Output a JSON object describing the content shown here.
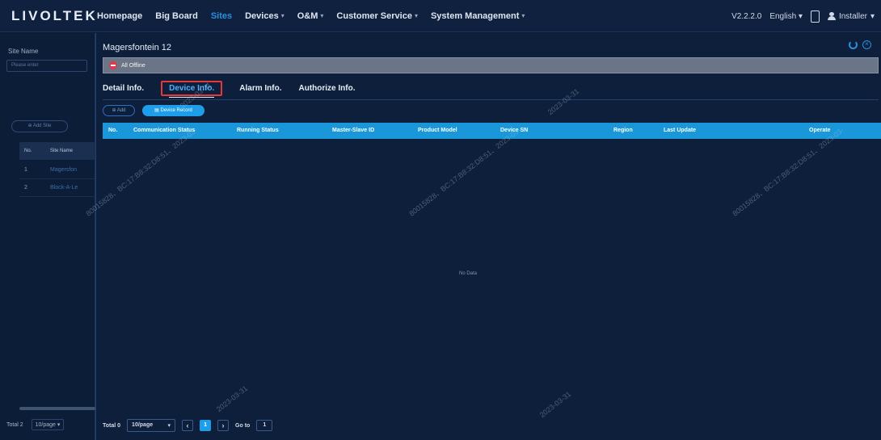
{
  "app": {
    "logo": "LIVOLTEK"
  },
  "nav": [
    {
      "label": "Homepage",
      "caret": false
    },
    {
      "label": "Big Board",
      "caret": false
    },
    {
      "label": "Sites",
      "caret": false,
      "active": true
    },
    {
      "label": "Devices",
      "caret": true
    },
    {
      "label": "O&M",
      "caret": true
    },
    {
      "label": "Customer Service",
      "caret": true
    },
    {
      "label": "System Management",
      "caret": true
    }
  ],
  "topright": {
    "version": "V2.2.2.0",
    "language": "English",
    "user": "Installer"
  },
  "left": {
    "site_name_label": "Site Name",
    "search_placeholder": "Please enter",
    "add_site": "⊕ Add Site",
    "col_no": "No.",
    "col_site": "Site Name",
    "rows": [
      {
        "no": "1",
        "name": "Magersfon"
      },
      {
        "no": "2",
        "name": "Block-A-Le"
      }
    ],
    "total": "Total 2",
    "page_size": "10/page"
  },
  "modal": {
    "title": "Magersfontein 12",
    "status": "All Offline",
    "tabs": [
      "Detail Info.",
      "Device Info.",
      "Alarm Info.",
      "Authorize Info."
    ],
    "active_tab": "Device Info.",
    "add_label": "⊕ Add",
    "record_label": "▤ Device Record",
    "columns": [
      "No.",
      "Communication Status",
      "Running Status",
      "Master-Slave ID",
      "Product Model",
      "Device SN",
      "Region",
      "Last Update",
      "Operate"
    ],
    "empty": "No Data",
    "pager": {
      "total": "Total 0",
      "page_size": "10/page",
      "current": "1",
      "goto_label": "Go to",
      "goto_value": "1"
    }
  },
  "watermarks": [
    "2023-03-31",
    "80015828、BC:17:B8:32:D8:51、2023-03-"
  ],
  "colors": {
    "accent": "#1e9de8",
    "offline": "#e0394a",
    "background": "#0d1f3b"
  }
}
